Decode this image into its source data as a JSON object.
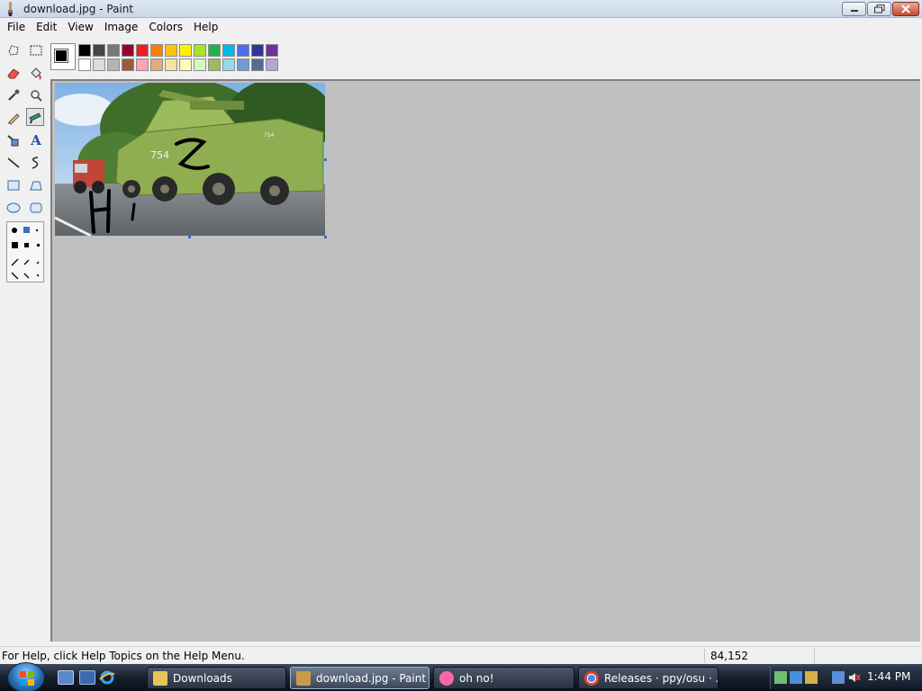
{
  "window": {
    "title": "download.jpg - Paint",
    "min": "0",
    "max": "1",
    "close": "r"
  },
  "menu": [
    "File",
    "Edit",
    "View",
    "Image",
    "Colors",
    "Help"
  ],
  "tools": [
    "free-select",
    "rect-select",
    "eraser",
    "fill-bucket",
    "color-picker",
    "magnifier",
    "pencil",
    "brush",
    "airbrush",
    "text",
    "line",
    "curve",
    "rectangle",
    "polygon",
    "ellipse",
    "rounded-rectangle"
  ],
  "text_tool_glyph": "A",
  "palette": {
    "top": [
      "#000000",
      "#464646",
      "#787878",
      "#990030",
      "#ed1c24",
      "#ff7e00",
      "#ffc20e",
      "#fff200",
      "#a8e61d",
      "#22b14c",
      "#00b7ef",
      "#4d6df3",
      "#2f3699",
      "#6f3198"
    ],
    "bottom": [
      "#ffffff",
      "#dcdcdc",
      "#b4b4b4",
      "#9c5a3c",
      "#ffa3b1",
      "#e5aa7a",
      "#f5e49c",
      "#fff9bd",
      "#d3f9bc",
      "#9dbb61",
      "#99d9ea",
      "#709ad1",
      "#546d8e",
      "#b5a5d5"
    ]
  },
  "status": {
    "help": "For Help, click Help Topics on the Help Menu.",
    "coords": "84,152"
  },
  "taskbar": {
    "tasks": [
      "Downloads",
      "download.jpg - Paint",
      "oh no!",
      "Releases · ppy/osu · ..."
    ],
    "clock": "1:44 PM"
  },
  "image_text": {
    "plate": "754"
  }
}
